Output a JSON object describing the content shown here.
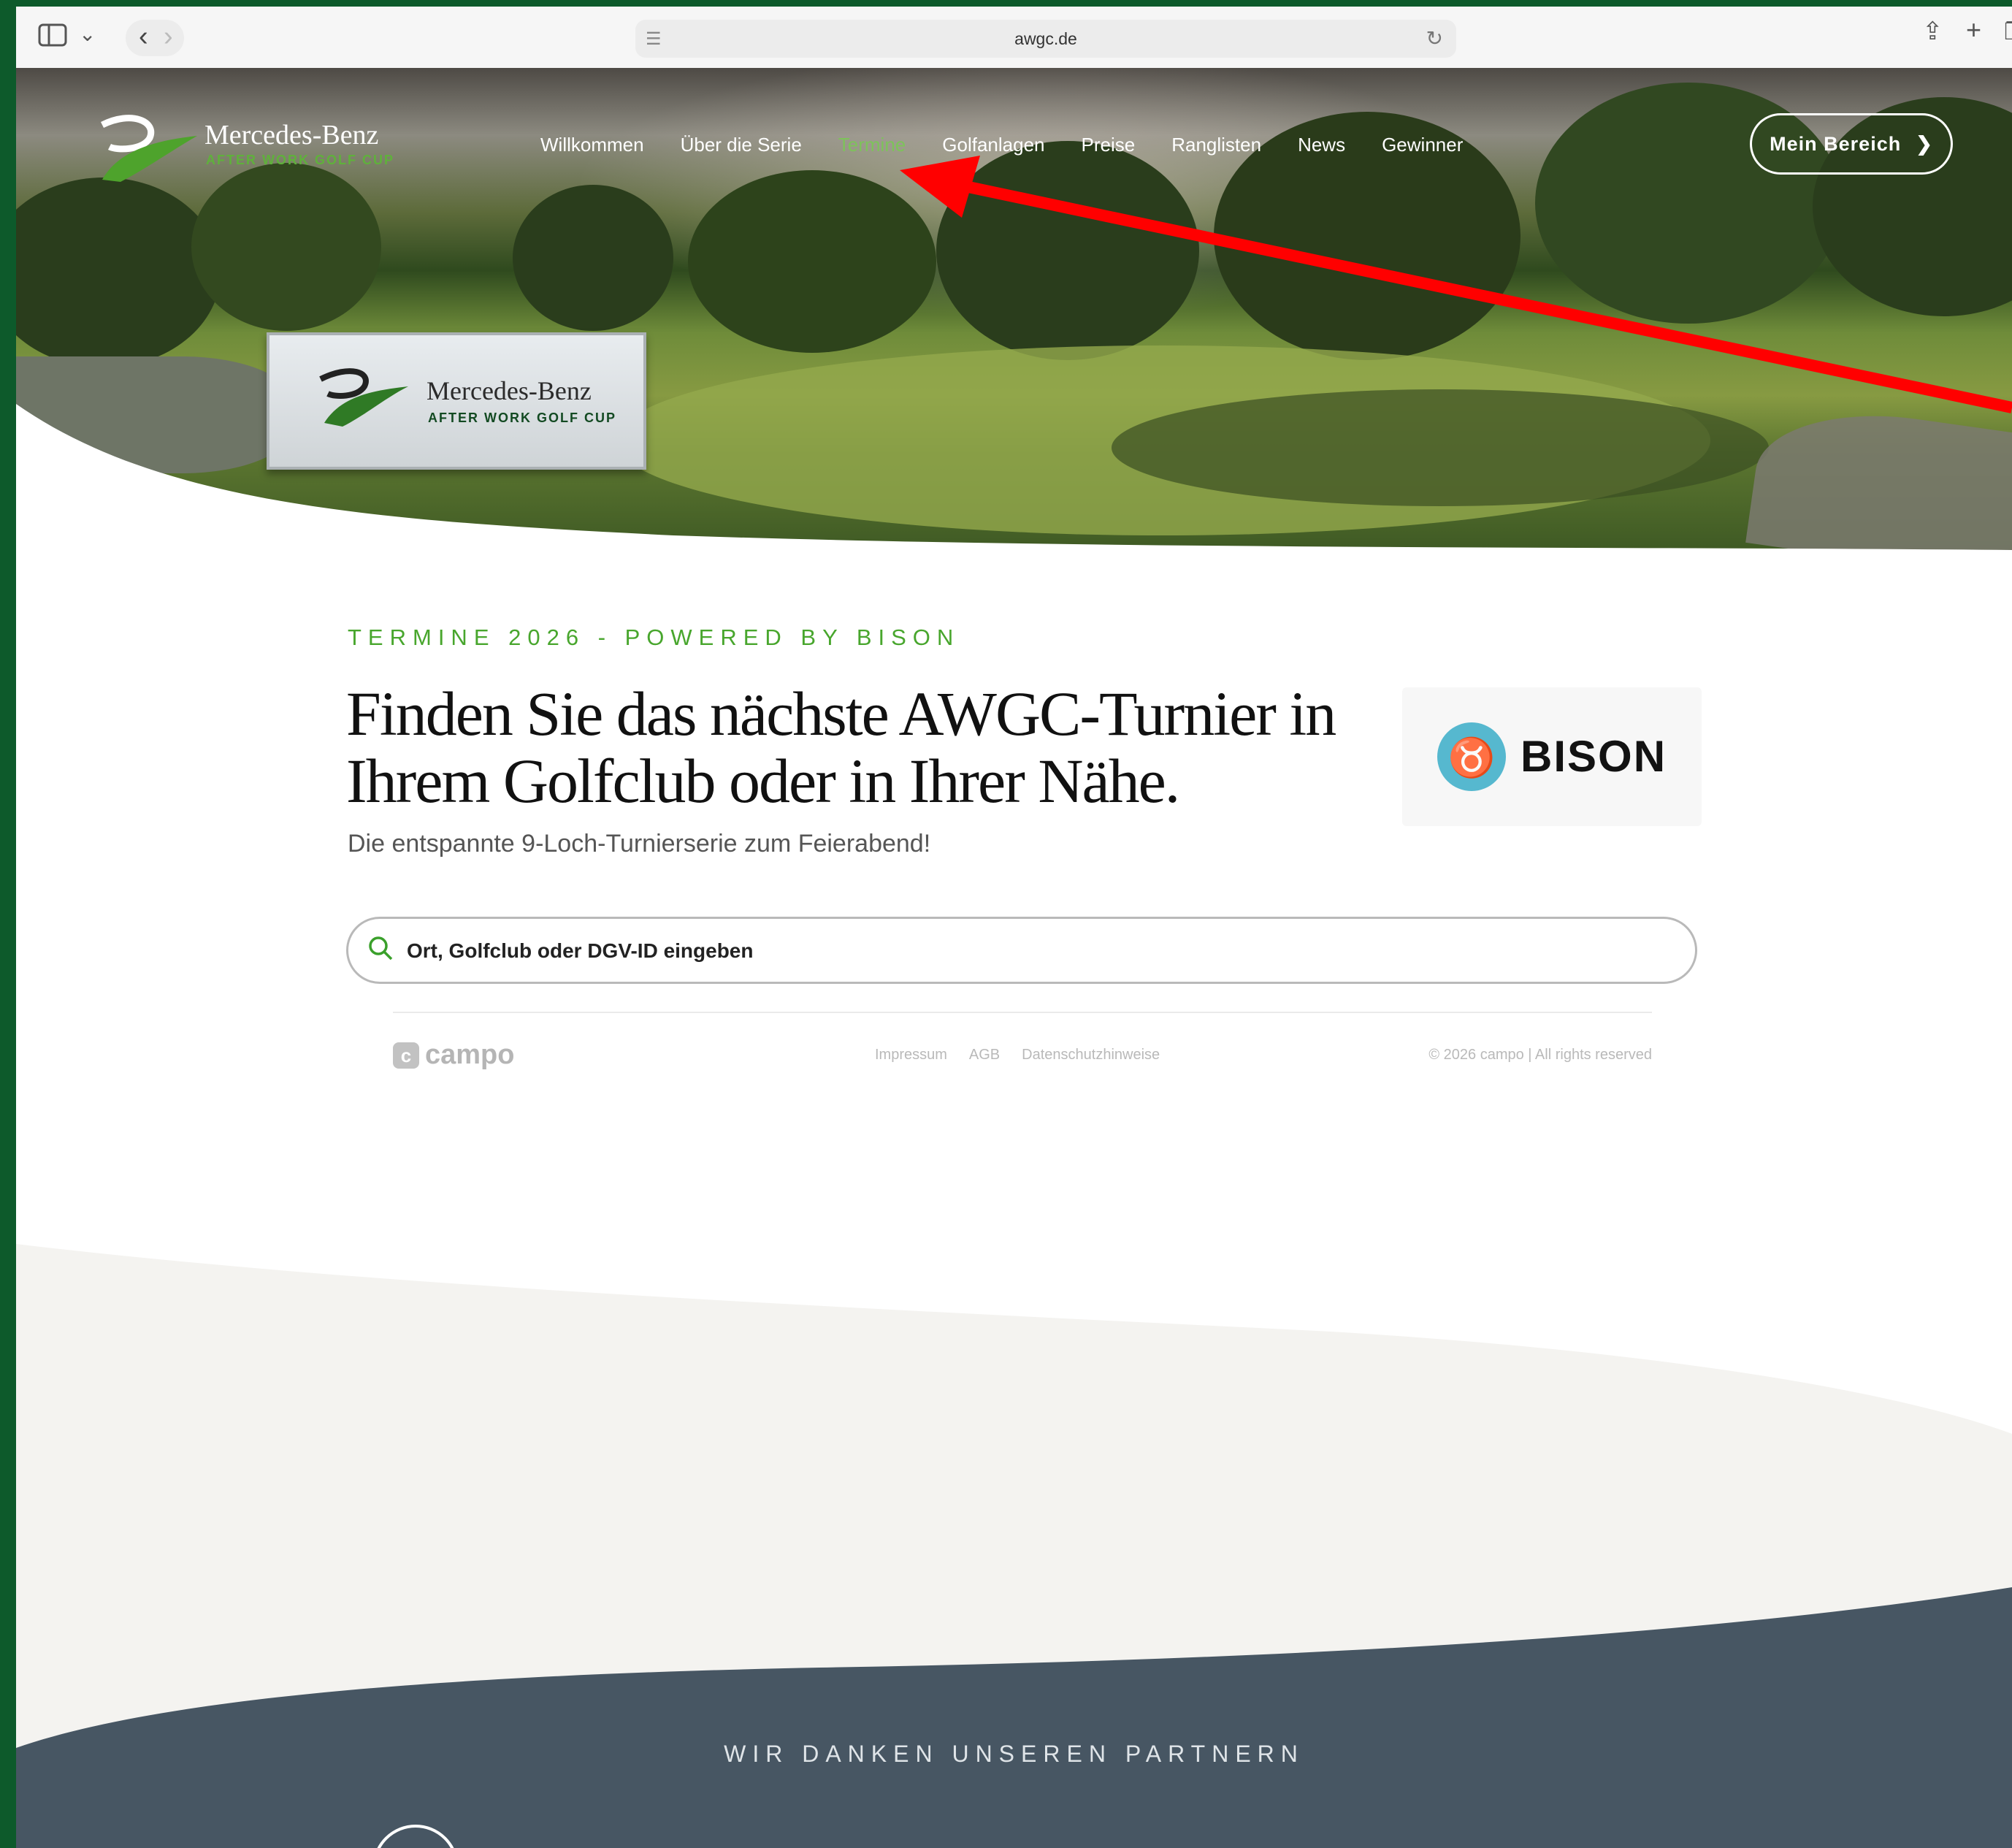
{
  "browser": {
    "url": "awgc.de",
    "icons": [
      "sidebar-icon",
      "chevron-down-icon",
      "back-icon",
      "forward-icon",
      "page-icon",
      "reload-icon",
      "share-icon",
      "plus-icon",
      "tabs-icon"
    ]
  },
  "header": {
    "logo_brand": "Mercedes-Benz",
    "logo_subtitle": "AFTER WORK GOLF CUP",
    "nav": [
      "Willkommen",
      "Über die Serie",
      "Termine",
      "Golfanlagen",
      "Preise",
      "Ranglisten",
      "News",
      "Gewinner"
    ],
    "active_nav": "Termine",
    "account_button": "Mein Bereich"
  },
  "hero_sign": {
    "brand": "Mercedes-Benz",
    "subtitle": "AFTER WORK GOLF CUP"
  },
  "main": {
    "kicker": "TERMINE 2026 - POWERED BY BISON",
    "headline_line1": "Finden Sie das nächste AWGC-Turnier in",
    "headline_line2": "Ihrem Golfclub oder in Ihrer Nähe.",
    "subline": "Die entspannte 9-Loch-Turnierserie zum Feierabend!",
    "sponsor": "BISON",
    "search_placeholder": "Ort, Golfclub oder DGV-ID eingeben"
  },
  "embed_footer": {
    "logo": "campo",
    "links": [
      "Impressum",
      "AGB",
      "Datenschutzhinweise"
    ],
    "copyright": "© 2026 campo | All rights reserved"
  },
  "partners": {
    "title": "WIR DANKEN UNSEREN PARTNERN"
  },
  "colors": {
    "accent_green": "#48a62d",
    "nav_active": "#7dc35a",
    "footer_slate": "#475663",
    "window_frame": "#0d5a2b",
    "annotation_arrow": "#ff0000"
  }
}
